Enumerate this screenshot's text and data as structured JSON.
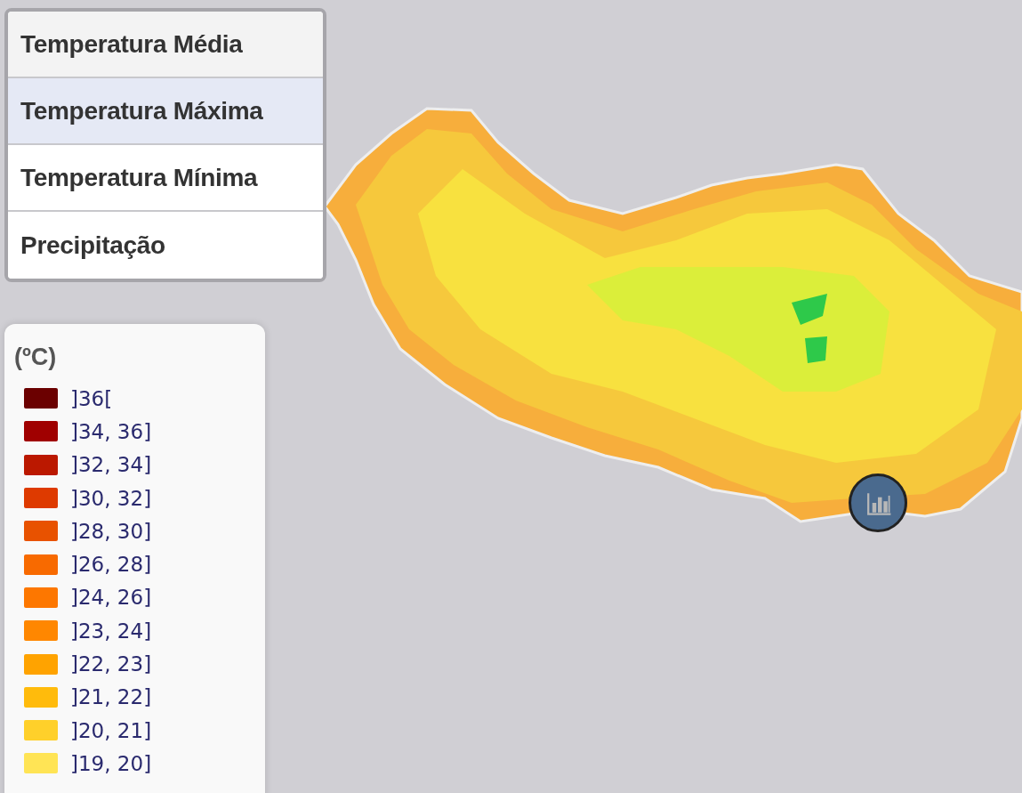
{
  "layer_menu": [
    {
      "label": "Temperatura Média",
      "selected": false,
      "hovered": true
    },
    {
      "label": "Temperatura Máxima",
      "selected": true,
      "hovered": false
    },
    {
      "label": "Temperatura Mínima",
      "selected": false,
      "hovered": false
    },
    {
      "label": "Precipitação",
      "selected": false,
      "hovered": false
    }
  ],
  "legend": {
    "title": "(ºC)",
    "items": [
      {
        "label": "]36[",
        "color": "#6b0000"
      },
      {
        "label": "]34, 36]",
        "color": "#a00000"
      },
      {
        "label": "]32, 34]",
        "color": "#bb1800"
      },
      {
        "label": "]30, 32]",
        "color": "#de3a00"
      },
      {
        "label": "]28, 30]",
        "color": "#e85200"
      },
      {
        "label": "]26, 28]",
        "color": "#f86a00"
      },
      {
        "label": "]24, 26]",
        "color": "#fd7700"
      },
      {
        "label": "]23, 24]",
        "color": "#ff8700"
      },
      {
        "label": "]22, 23]",
        "color": "#ffa300"
      },
      {
        "label": "]21, 22]",
        "color": "#ffbb0c"
      },
      {
        "label": "]20, 21]",
        "color": "#ffd02a"
      },
      {
        "label": "]19, 20]",
        "color": "#ffe455"
      }
    ]
  }
}
